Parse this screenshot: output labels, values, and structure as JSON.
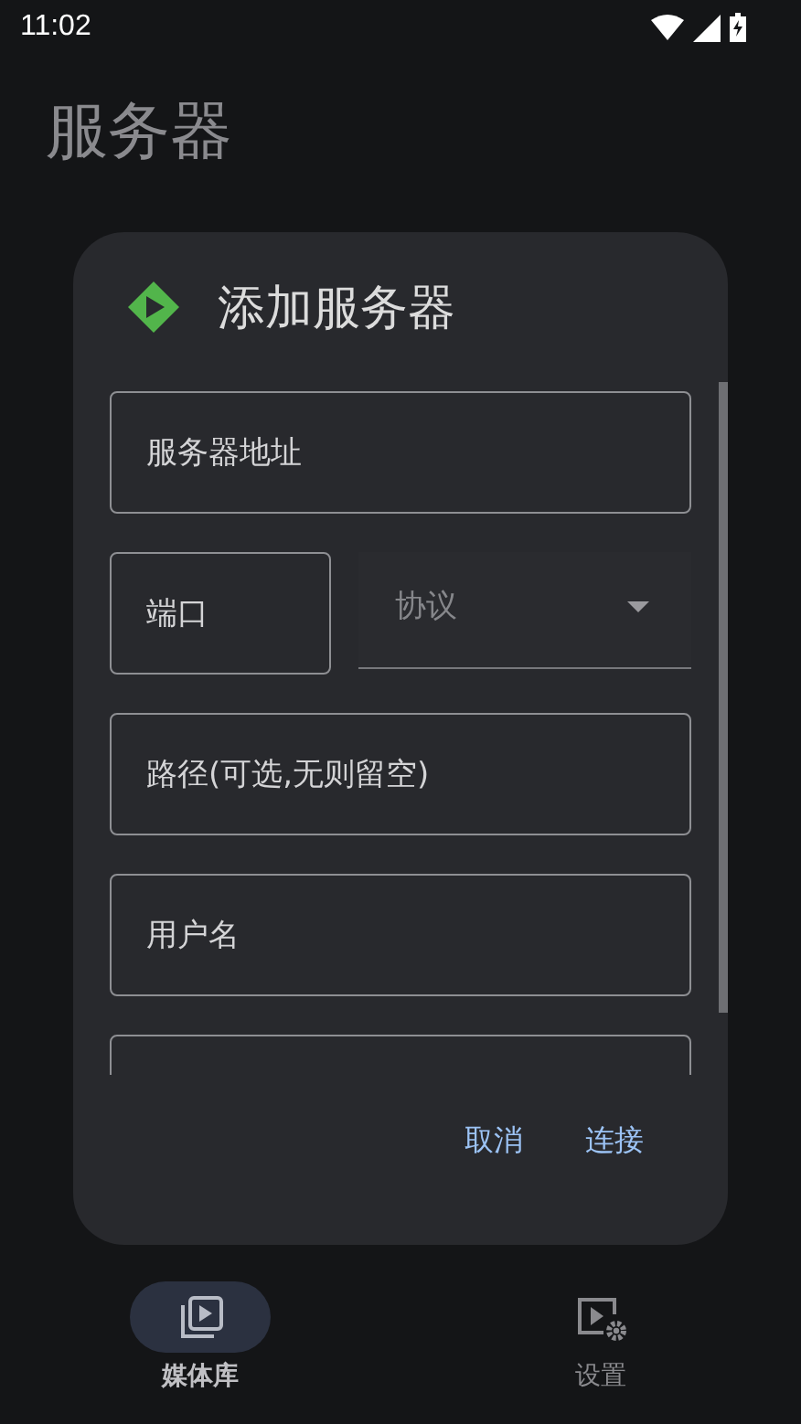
{
  "status_bar": {
    "time": "11:02"
  },
  "page_title": "服务器",
  "dialog": {
    "title": "添加服务器",
    "rows": [
      [
        {
          "kind": "outlined",
          "placeholder": "服务器地址"
        }
      ],
      [
        {
          "kind": "outlined",
          "placeholder": "端口"
        },
        {
          "kind": "dropdown",
          "placeholder": "协议"
        }
      ],
      [
        {
          "kind": "outlined",
          "placeholder": "路径(可选,无则留空)"
        }
      ],
      [
        {
          "kind": "outlined",
          "placeholder": "用户名"
        }
      ],
      [
        {
          "kind": "outlined"
        }
      ]
    ],
    "buttons": [
      "取消",
      "连接"
    ]
  },
  "nav": [
    {
      "label": "媒体库",
      "selected": true,
      "kind": "library"
    },
    {
      "label": "设置",
      "selected": false,
      "kind": "settings"
    }
  ]
}
